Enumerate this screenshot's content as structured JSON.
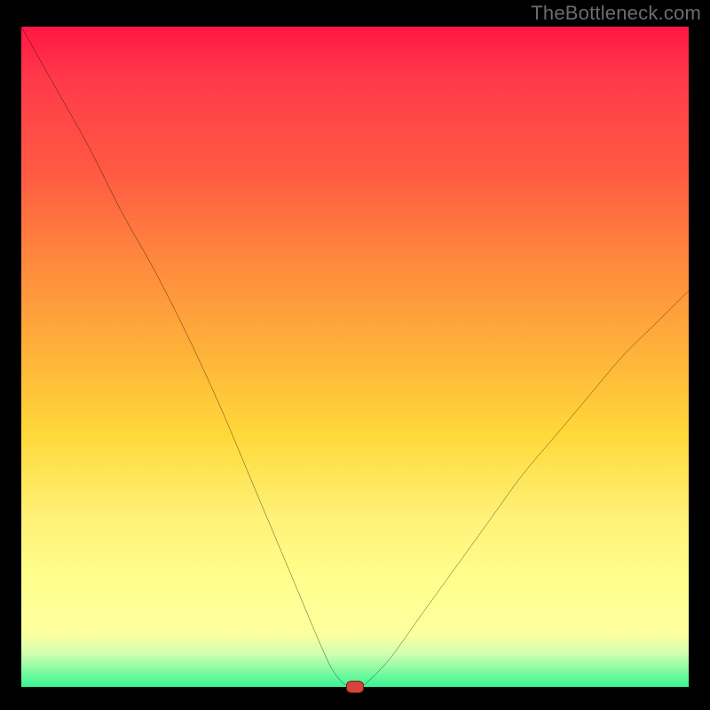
{
  "watermark": "TheBottleneck.com",
  "chart_data": {
    "type": "line",
    "title": "",
    "xlabel": "",
    "ylabel": "",
    "xlim": [
      0,
      100
    ],
    "ylim": [
      0,
      100
    ],
    "x": [
      0,
      5,
      10,
      15,
      20,
      25,
      30,
      35,
      40,
      45,
      47,
      49,
      50,
      51,
      55,
      60,
      65,
      70,
      75,
      80,
      85,
      90,
      95,
      100
    ],
    "values": [
      100,
      91,
      82,
      72,
      63,
      53,
      42,
      30,
      18,
      6,
      2,
      0,
      0,
      0,
      4,
      11,
      18,
      25,
      32,
      38,
      44,
      50,
      55,
      60
    ],
    "marker": {
      "x": 50,
      "y": 0
    }
  },
  "colors": {
    "curve": "#000000",
    "marker_fill": "#d3443c",
    "marker_border": "#7a1f16",
    "gradient_top": "#ff1744",
    "gradient_bottom": "#38f594",
    "watermark": "#6c6c6c"
  }
}
